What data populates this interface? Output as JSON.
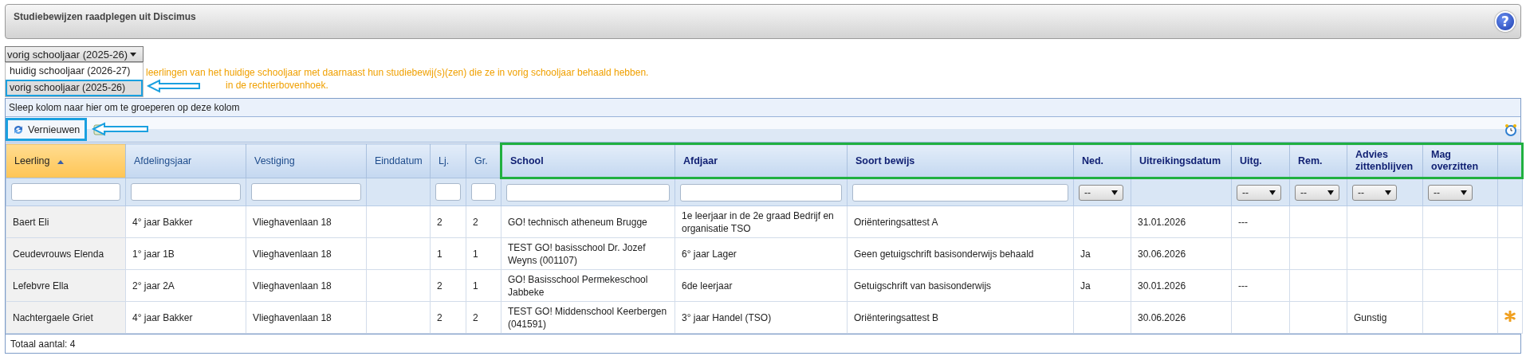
{
  "window": {
    "title": "Studiebewijzen raadplegen uit Discimus",
    "help": "?"
  },
  "year_select": {
    "value": "vorig schooljaar (2025-26)",
    "expanded": true,
    "options": [
      {
        "label": "huidig schooljaar (2026-27)",
        "selected": false
      },
      {
        "label": "vorig schooljaar (2025-26)",
        "selected": true
      }
    ]
  },
  "info_lines": [
    "leerlingen van het huidige schooljaar met daarnaast hun studiebewij(s)(zen) die ze in vorig schooljaar behaald hebben.",
    "in de rechterbovenhoek."
  ],
  "group_panel": "Sleep kolom naar hier om te groeperen op deze kolom",
  "toolbar": {
    "refresh": "Vernieuwen"
  },
  "table": {
    "columns": [
      {
        "label": "Leerling",
        "sorted": true,
        "highlighted": false,
        "filter": {
          "kind": "text"
        }
      },
      {
        "label": "Afdelingsjaar",
        "sorted": false,
        "highlighted": false,
        "filter": {
          "kind": "text"
        }
      },
      {
        "label": "Vestiging",
        "sorted": false,
        "highlighted": false,
        "filter": {
          "kind": "text"
        }
      },
      {
        "label": "Einddatum",
        "sorted": false,
        "highlighted": false
      },
      {
        "label": "Lj.",
        "sorted": false,
        "highlighted": false,
        "filter": {
          "kind": "text"
        }
      },
      {
        "label": "Gr.",
        "sorted": false,
        "highlighted": false,
        "filter": {
          "kind": "text"
        }
      },
      {
        "label": "School",
        "sorted": false,
        "highlighted": true,
        "filter": {
          "kind": "text"
        }
      },
      {
        "label": "Afdjaar",
        "sorted": false,
        "highlighted": true,
        "filter": {
          "kind": "text"
        }
      },
      {
        "label": "Soort bewijs",
        "sorted": false,
        "highlighted": true,
        "filter": {
          "kind": "text"
        }
      },
      {
        "label": "Ned.",
        "sorted": false,
        "highlighted": true,
        "filter": {
          "kind": "select",
          "value": "--"
        }
      },
      {
        "label": "Uitreikingsdatum",
        "sorted": false,
        "highlighted": true
      },
      {
        "label": "Uitg.",
        "sorted": false,
        "highlighted": true,
        "filter": {
          "kind": "select",
          "value": "--"
        }
      },
      {
        "label": "Rem.",
        "sorted": false,
        "highlighted": true,
        "filter": {
          "kind": "select",
          "value": "--"
        }
      },
      {
        "label": "Advies zittenblijven",
        "sorted": false,
        "highlighted": true,
        "filter": {
          "kind": "select",
          "value": "--"
        }
      },
      {
        "label": "Mag overzitten",
        "sorted": false,
        "highlighted": true,
        "filter": {
          "kind": "select",
          "value": "--"
        }
      },
      {
        "sorted": false,
        "highlighted": true
      }
    ],
    "rows": [
      {
        "cells": [
          "Baert Eli",
          "4° jaar Bakker",
          "Vlieghavenlaan 18",
          null,
          "2",
          "2",
          "GO! technisch atheneum Brugge",
          "1e leerjaar in de 2e graad Bedrijf en organisatie TSO",
          "Oriënteringsattest A",
          null,
          "31.01.2026",
          "---",
          null,
          null,
          null
        ],
        "marked": false
      },
      {
        "cells": [
          "Ceudevrouws Elenda",
          "1° jaar 1B",
          "Vlieghavenlaan 18",
          null,
          "1",
          "1",
          "TEST GO! basisschool Dr. Jozef Weyns (001107)",
          "6° jaar Lager",
          "Geen getuigschrift basisonderwijs behaald",
          "Ja",
          "30.06.2026",
          null,
          null,
          null,
          null
        ],
        "marked": false
      },
      {
        "cells": [
          "Lefebvre Ella",
          "2° jaar 2A",
          "Vlieghavenlaan 18",
          null,
          "2",
          "1",
          "GO! Basisschool Permekeschool Jabbeke",
          "6de leerjaar",
          "Getuigschrift van basisonderwijs",
          "Ja",
          "30.01.2026",
          "---",
          null,
          null,
          null
        ],
        "marked": false
      },
      {
        "cells": [
          "Nachtergaele Griet",
          "4° jaar Bakker",
          "Vlieghavenlaan 18",
          null,
          "2",
          "2",
          "TEST GO! Middenschool Keerbergen (041591)",
          "3° jaar Handel (TSO)",
          "Oriënteringsattest B",
          null,
          "30.06.2026",
          null,
          null,
          "Gunstig",
          null
        ],
        "marked": true
      }
    ],
    "footer": "Totaal aantal: 4"
  }
}
